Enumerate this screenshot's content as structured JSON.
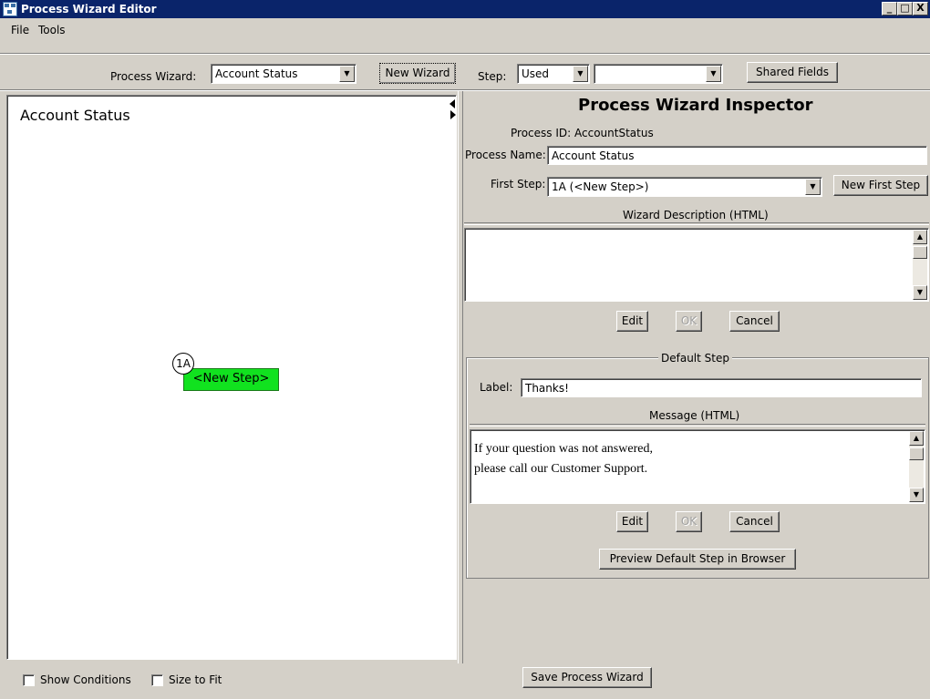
{
  "window": {
    "title": "Process Wizard Editor",
    "buttons": [
      "_",
      "□",
      "X"
    ]
  },
  "menu": {
    "items": [
      "File",
      "Tools"
    ]
  },
  "toolbar": {
    "process_wizard_label": "Process Wizard:",
    "process_wizard_value": "Account Status",
    "new_wizard_label": "New Wizard",
    "step_label": "Step:",
    "step_value": "Used",
    "step_select_value": "",
    "shared_fields_label": "Shared Fields"
  },
  "canvas": {
    "title": "Account Status",
    "node": {
      "id": "1A",
      "label": "<New Step>",
      "color": "#11e21f"
    }
  },
  "inspector": {
    "title": "Process Wizard Inspector",
    "process_id_label": "Process ID:",
    "process_id_value": "AccountStatus",
    "process_name_label": "Process Name:",
    "process_name_value": "Account Status",
    "first_step_label": "First Step:",
    "first_step_value": "1A (<New Step>)",
    "new_first_step_label": "New First Step",
    "wizard_description_label": "Wizard Description (HTML)",
    "wizard_description_value": "",
    "edit_label": "Edit",
    "ok_label": "OK",
    "cancel_label": "Cancel",
    "default_step": {
      "title": "Default Step",
      "label_label": "Label:",
      "label_value": "Thanks!",
      "message_label": "Message (HTML)",
      "message_line1": "If your question was not answered,",
      "message_line2": "please call our Customer Support.",
      "edit_label": "Edit",
      "ok_label": "OK",
      "cancel_label": "Cancel",
      "preview_label": "Preview Default Step in Browser"
    }
  },
  "footer": {
    "show_conditions_label": "Show Conditions",
    "size_to_fit_label": "Size to Fit",
    "save_label": "Save Process Wizard"
  }
}
